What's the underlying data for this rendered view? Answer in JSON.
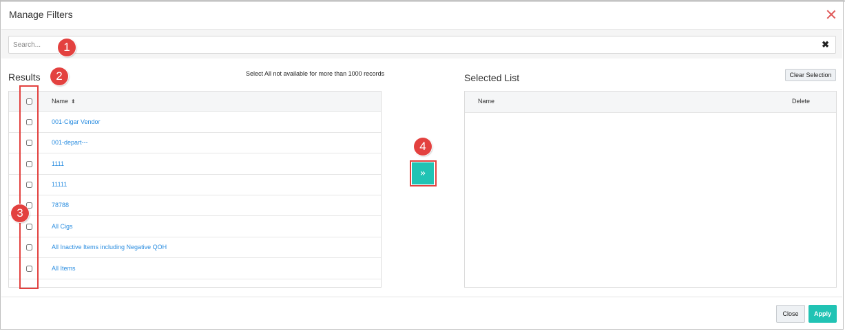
{
  "dialog": {
    "title": "Manage Filters"
  },
  "search": {
    "placeholder": "Search...",
    "clear_icon": "✖"
  },
  "results": {
    "label": "Results",
    "note": "Select All not available for more than 1000 records",
    "column_name": "Name",
    "sort_icon": "⬍",
    "items": [
      "001-Cigar Vendor",
      "001-depart---",
      "1111",
      "11111",
      "78788",
      "All Cigs",
      "All Inactive Items including Negative QOH",
      "All Items"
    ]
  },
  "move_button": {
    "label": "»"
  },
  "selected": {
    "label": "Selected List",
    "clear_label": "Clear Selection",
    "column_name": "Name",
    "column_delete": "Delete"
  },
  "footer": {
    "close_label": "Close",
    "apply_label": "Apply"
  },
  "annotations": {
    "m1": "1",
    "m2": "2",
    "m3": "3",
    "m4": "4"
  },
  "colors": {
    "accent": "#21c3b4",
    "link": "#2a8de0",
    "marker": "#e3413f",
    "close_x": "#e05a5a"
  }
}
